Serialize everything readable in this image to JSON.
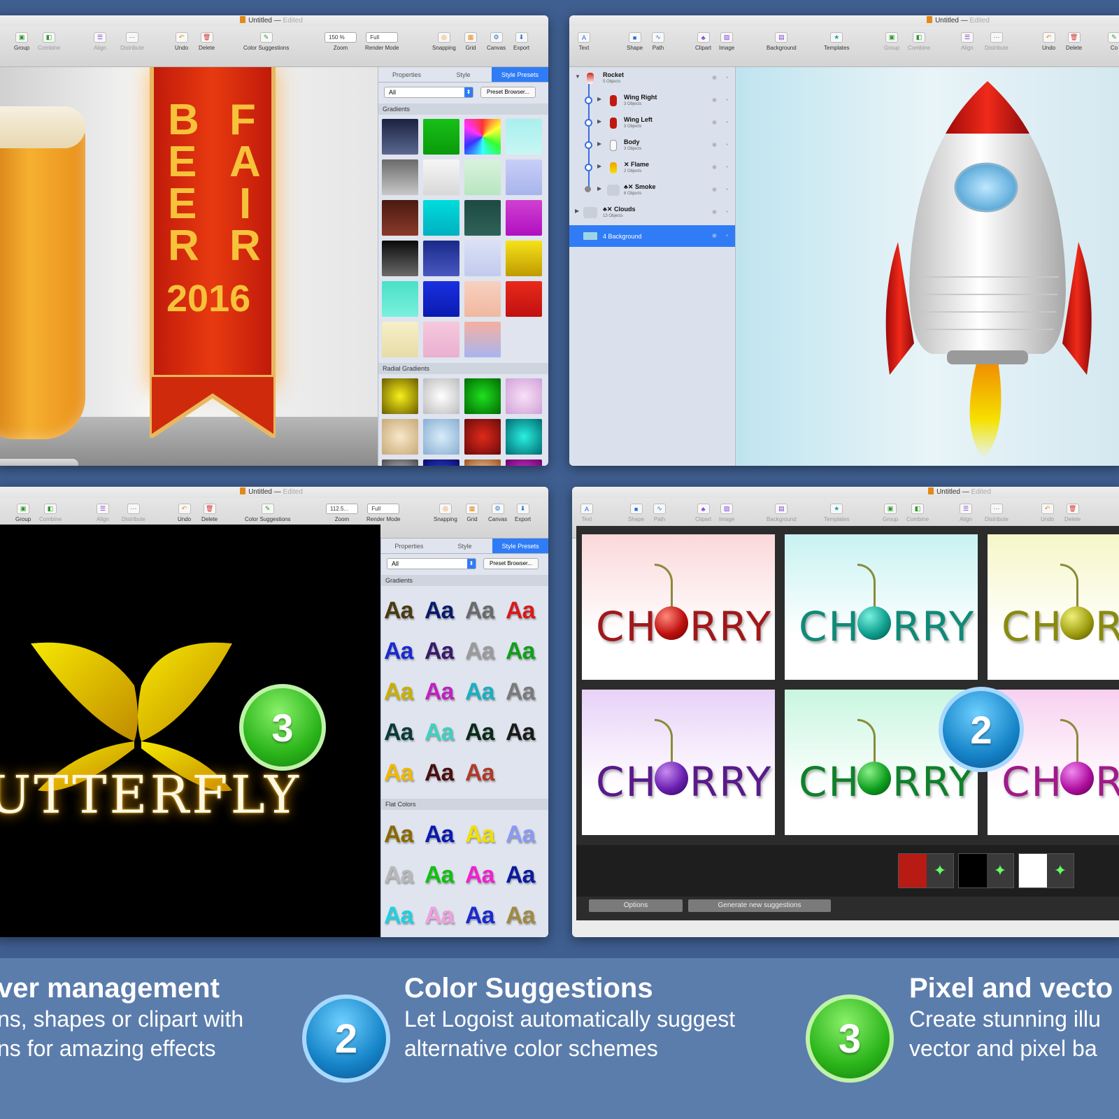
{
  "windows": {
    "beer": {
      "title": "Untitled",
      "title_state": "Edited",
      "toolbar": [
        "Group",
        "Combine",
        "Align",
        "Distribute",
        "Undo",
        "Delete",
        "Color Suggestions",
        "Zoom",
        "Render Mode",
        "Snapping",
        "Grid",
        "Canvas",
        "Export"
      ],
      "zoom_value": "150 %",
      "render_value": "Full",
      "canvas_text": [
        "B",
        "E",
        "E",
        "R",
        "F",
        "A",
        "I",
        "R",
        "2016"
      ],
      "tabs": [
        "Properties",
        "Style",
        "Style Presets"
      ],
      "filter": "All",
      "preset_browser": "Preset Browser...",
      "sections": [
        "Gradients",
        "Radial Gradients"
      ],
      "gradient_swatches": [
        "linear-gradient(#1b2240,#5a6890)",
        "linear-gradient(#17c017,#0a9a0a)",
        "conic-gradient(#f33,#ff3,#3f3,#3ff,#33f,#f3f,#f33)",
        "linear-gradient(#a8f0ee,#c8f6f4)",
        "linear-gradient(#6a6a6a,#c8c8c8)",
        "linear-gradient(#f6f6f6,#d8d8d8)",
        "linear-gradient(#d8f2dc,#b8e6c0)",
        "linear-gradient(#c8cef8,#a8b4ea)",
        "linear-gradient(#4a1a10,#8a3a2a)",
        "linear-gradient(#00dcdc,#00b0c0)",
        "linear-gradient(#1e4a42,#2e6258)",
        "linear-gradient(#d040d0,#b010c0)",
        "linear-gradient(#0a0a0a,#6a6a6a)",
        "linear-gradient(#1a2a8a,#4858c0)",
        "linear-gradient(#dae0f6,#c2cbee)",
        "linear-gradient(#f6e21a,#c09a00)",
        "linear-gradient(#4ae0c8,#7af0dc)",
        "linear-gradient(#1a30e0,#0a1ab0)",
        "linear-gradient(#f8d0c0,#f0b8a0)",
        "linear-gradient(#e82a1a,#c01010)",
        "linear-gradient(#f6efc8,#e8dca8)",
        "linear-gradient(#f6c8dc,#eab0d0)",
        "linear-gradient(#f6b0a0,#a8b4f0)"
      ],
      "radial_swatches": [
        "radial-gradient(#f6f01a,#6a5a00)",
        "radial-gradient(#ffffff,#bcbcbc)",
        "radial-gradient(#20e020,#006a00)",
        "radial-gradient(#f8e0f6,#d0a0d8)",
        "radial-gradient(#f6e8c8,#c8a878)",
        "radial-gradient(#d8ecfa,#88aed0)",
        "radial-gradient(#e02a1a,#6a0a0a)",
        "radial-gradient(#2af0e0,#006a70)",
        "radial-gradient(#c8c8c8,#4a4a4a)",
        "radial-gradient(#2a4ae0,#0a0a6a)",
        "radial-gradient(#f6e0c0,#a0501a)",
        "radial-gradient(#e040e0,#6a006a)"
      ]
    },
    "rocket": {
      "title": "Untitled",
      "title_state": "Edited",
      "toolbar": [
        "Text",
        "Shape",
        "Path",
        "Clipart",
        "Image",
        "Background",
        "Templates",
        "Group",
        "Combine",
        "Align",
        "Distribute",
        "Undo",
        "Delete",
        "Co"
      ],
      "layers": [
        {
          "name": "Rocket",
          "sub": "5 Objects"
        },
        {
          "name": "Wing Right",
          "sub": "3 Objects"
        },
        {
          "name": "Wing Left",
          "sub": "3 Objects"
        },
        {
          "name": "Body",
          "sub": "3 Objects"
        },
        {
          "name": "✕ Flame",
          "sub": "2 Objects"
        },
        {
          "name": "♣✕ Smoke",
          "sub": "6 Objects"
        },
        {
          "name": "♣✕ Clouds",
          "sub": "13 Objects"
        },
        {
          "name": "4 Background",
          "sub": ""
        }
      ]
    },
    "butterfly": {
      "title": "Untitled",
      "title_state": "Edited",
      "toolbar": [
        "Group",
        "Combine",
        "Align",
        "Distribute",
        "Undo",
        "Delete",
        "Color Suggestions",
        "Zoom",
        "Render Mode",
        "Snapping",
        "Grid",
        "Canvas",
        "Export"
      ],
      "zoom_value": "112.5...",
      "render_value": "Full",
      "canvas_text": "UTTERFLY",
      "tabs": [
        "Properties",
        "Style",
        "Style Presets"
      ],
      "filter": "All",
      "preset_browser": "Preset Browser...",
      "sections": [
        "Gradients",
        "Flat Colors"
      ],
      "text_sample": "Aa",
      "gradient_text_colors": [
        "#4a3a10",
        "#0a1a6a",
        "#6a6a6a",
        "#d81a1a",
        "#1a2ad0",
        "#3a1a6a",
        "#9a9a9a",
        "#10a01a",
        "#c8b000",
        "#c020c0",
        "#18b0c0",
        "#7a7a7a",
        "#0a3a3a",
        "#40d0c0",
        "#0a2a1a",
        "#1a1a1a",
        "#f0b800",
        "#4a1010",
        "#b03a2a"
      ],
      "flat_text_colors": [
        "#8a6a00",
        "#0a1ab0",
        "#f0e000",
        "#8a9af0",
        "#b8b8b8",
        "#10c010",
        "#f020d0",
        "#0a1aa0",
        "#20d0e0",
        "#f0a0e0",
        "#1a2ad0",
        "#a08a40"
      ]
    },
    "cherry": {
      "title": "Untitled",
      "title_state": "Edited",
      "toolbar": [
        "Text",
        "Shape",
        "Path",
        "Clipart",
        "Image",
        "Background",
        "Templates",
        "Group",
        "Combine",
        "Align",
        "Distribute",
        "Undo",
        "Delete"
      ],
      "word_parts": [
        "CH",
        "RRY"
      ],
      "cards": [
        {
          "bg": "linear-gradient(#fbd8da,#ffffff 70%)",
          "text": "#a0181a",
          "ball": "radial-gradient(circle at 35% 30%,#ff8a7a,#c01010 55%,#5a0000)"
        },
        {
          "bg": "linear-gradient(#c8f2f2,#ffffff 70%)",
          "text": "#108a78",
          "ball": "radial-gradient(circle at 35% 30%,#7af0e0,#10a090 55%,#004a40)"
        },
        {
          "bg": "linear-gradient(#f6f6c8,#ffffff 70%)",
          "text": "#8a8a10",
          "ball": "radial-gradient(circle at 35% 30%,#f0f07a,#a0a010 55%,#4a4a00)"
        },
        {
          "bg": "linear-gradient(#e8d2f8,#ffffff 70%)",
          "text": "#5a1a8a",
          "ball": "radial-gradient(circle at 35% 30%,#c88af0,#6a20b0 55%,#2a0050)"
        },
        {
          "bg": "linear-gradient(#c8f6e0,#ffffff 70%)",
          "text": "#10802a",
          "ball": "radial-gradient(circle at 35% 30%,#8af08a,#10a020 55%,#004a0a)"
        },
        {
          "bg": "linear-gradient(#f8d0f0,#ffffff 70%)",
          "text": "#a01a8a",
          "ball": "radial-gradient(circle at 35% 30%,#f08af0,#b010a0 55%,#4a0040)"
        }
      ],
      "buttons": {
        "options": "Options",
        "generate": "Generate new suggestions"
      },
      "palette_colors": [
        "#b81a14",
        "#000000",
        "#ffffff"
      ]
    }
  },
  "badges": {
    "two": "2",
    "three": "3"
  },
  "captions": [
    {
      "title": "ver management",
      "lines": [
        "ns, shapes or clipart with",
        "ns for amazing effects"
      ]
    },
    {
      "title": "Color Suggestions",
      "lines": [
        "Let Logoist automatically suggest",
        "alternative color schemes"
      ]
    },
    {
      "title": "Pixel and vecto",
      "lines": [
        "Create stunning illu",
        "vector and pixel ba"
      ]
    }
  ],
  "caption_badges": [
    "2",
    "3"
  ]
}
